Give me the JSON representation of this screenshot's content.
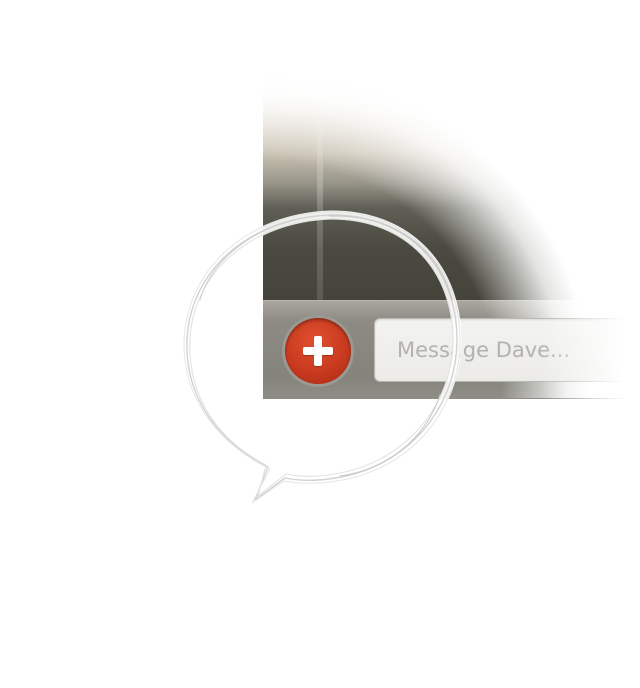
{
  "compose": {
    "add_button_label": "+",
    "message_placeholder": "Message Dave..."
  },
  "colors": {
    "accent_red": "#c93a1f",
    "bar_gray": "#8d8b83",
    "screen_dark": "#45443a"
  },
  "icons": {
    "add": "plus-icon",
    "annotation": "sketched-speech-bubble"
  }
}
